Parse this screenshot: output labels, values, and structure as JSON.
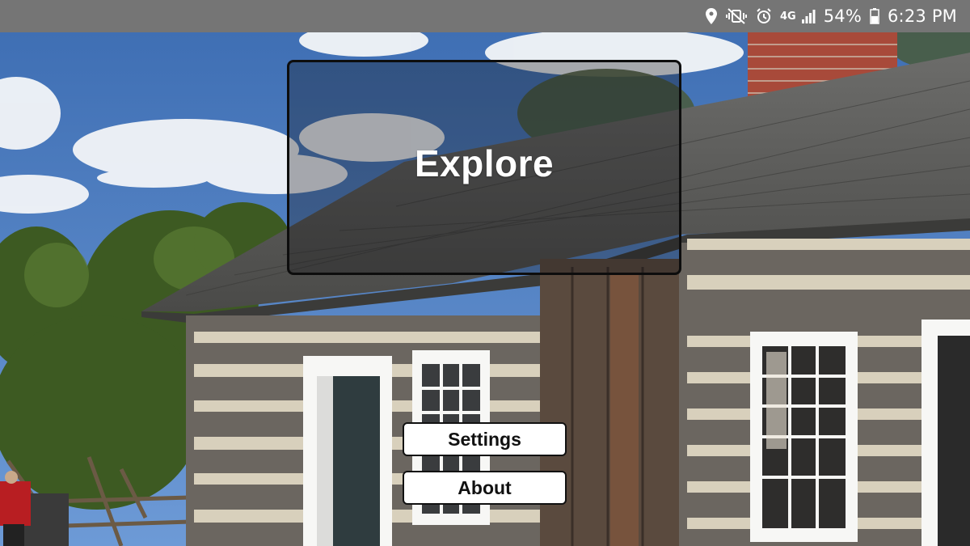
{
  "status_bar": {
    "icons": [
      "location-icon",
      "vibrate-icon",
      "alarm-icon",
      "network-icon",
      "signal-icon"
    ],
    "network_label": "4G",
    "battery_percent": "54%",
    "battery_level": 0.54,
    "time": "6:23 PM"
  },
  "main": {
    "explore_label": "Explore",
    "settings_label": "Settings",
    "about_label": "About"
  },
  "colors": {
    "status_bar_bg": "#757575",
    "button_bg": "#ffffff",
    "panel_border": "#0d0d0d"
  }
}
